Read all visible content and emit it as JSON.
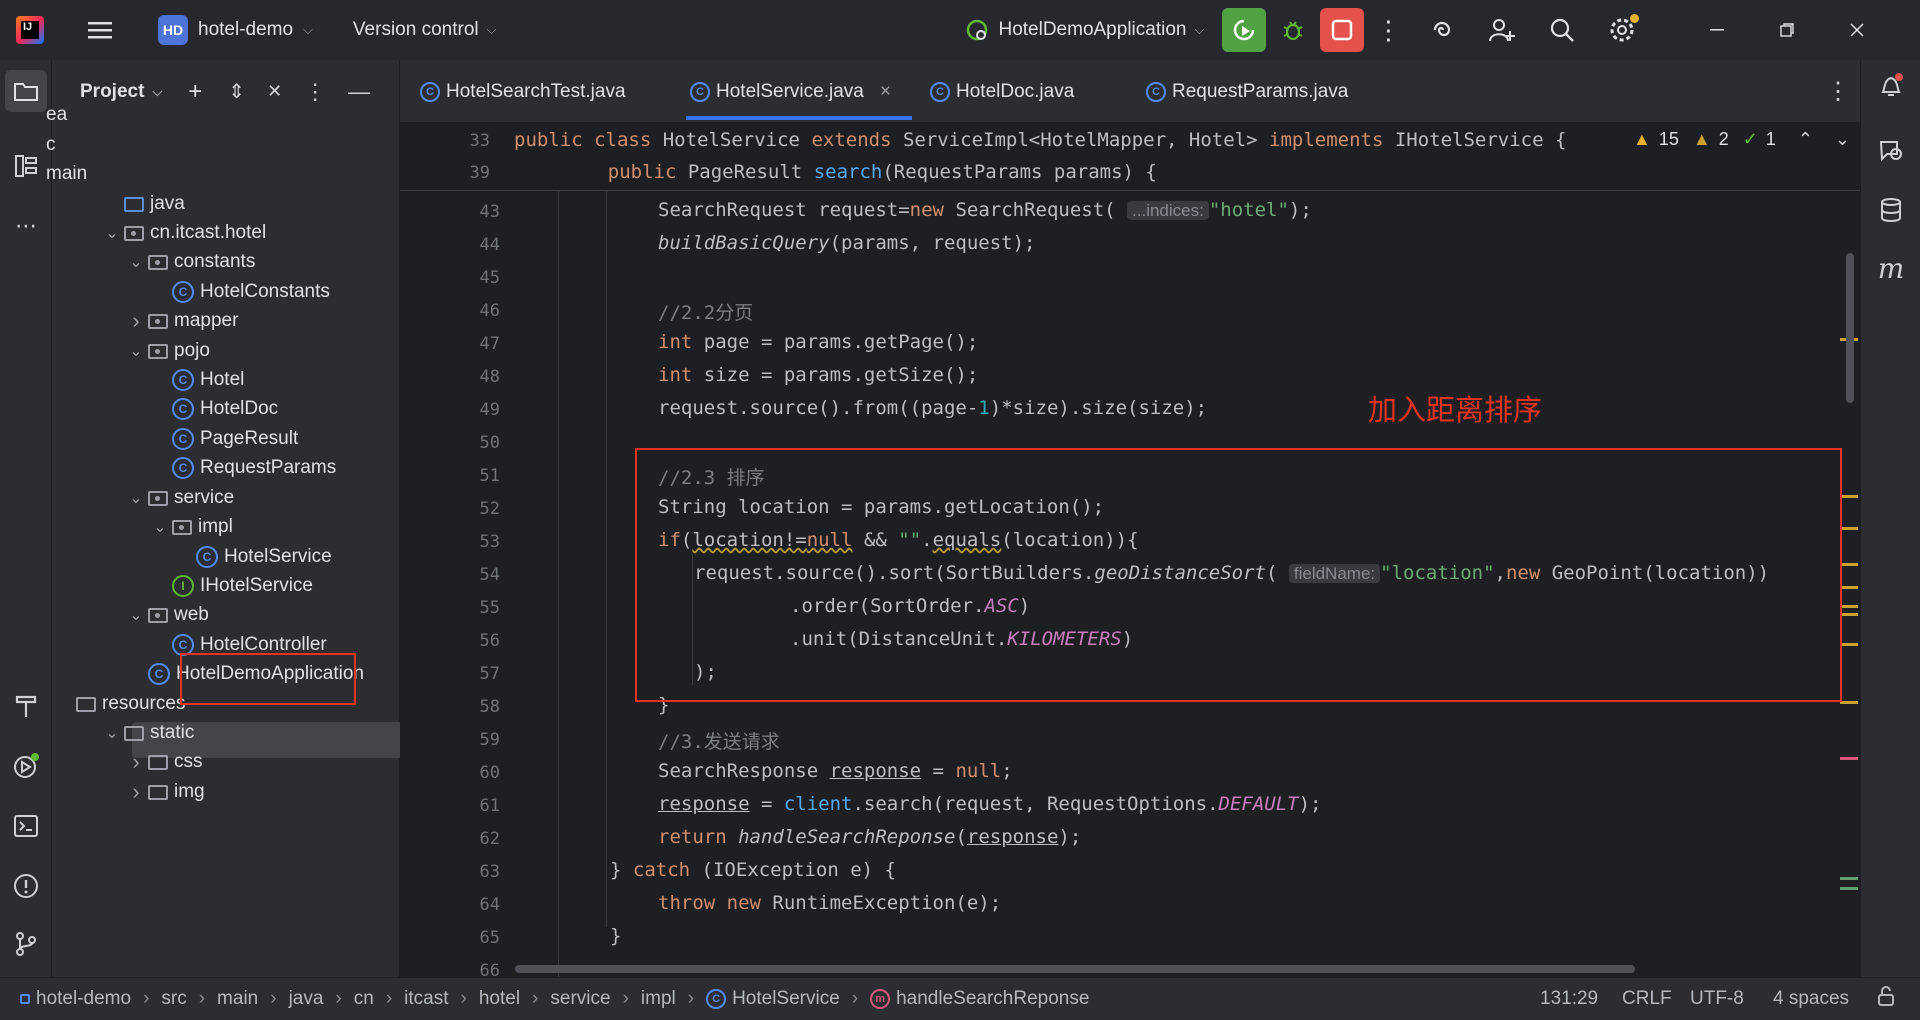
{
  "titlebar": {
    "logo_text": "IJ",
    "project_badge": "HD",
    "project_name": "hotel-demo",
    "vcs_label": "Version control",
    "run_config": "HotelDemoApplication"
  },
  "project_panel": {
    "title": "Project",
    "tree": [
      {
        "label": "ea",
        "indent": 0,
        "kind": "folder"
      },
      {
        "label": "c",
        "indent": 0,
        "kind": "folder"
      },
      {
        "label": "main",
        "indent": 0,
        "kind": "folder"
      },
      {
        "label": "java",
        "indent": 1,
        "kind": "folder-blue"
      },
      {
        "label": "cn.itcast.hotel",
        "indent": 1,
        "kind": "package"
      },
      {
        "label": "constants",
        "indent": 2,
        "kind": "package"
      },
      {
        "label": "HotelConstants",
        "indent": 3,
        "kind": "class"
      },
      {
        "label": "mapper",
        "indent": 2,
        "kind": "package"
      },
      {
        "label": "pojo",
        "indent": 2,
        "kind": "package"
      },
      {
        "label": "Hotel",
        "indent": 3,
        "kind": "class"
      },
      {
        "label": "HotelDoc",
        "indent": 3,
        "kind": "class"
      },
      {
        "label": "PageResult",
        "indent": 3,
        "kind": "class"
      },
      {
        "label": "RequestParams",
        "indent": 3,
        "kind": "class"
      },
      {
        "label": "service",
        "indent": 2,
        "kind": "package"
      },
      {
        "label": "impl",
        "indent": 3,
        "kind": "package"
      },
      {
        "label": "HotelService",
        "indent": 4,
        "kind": "class"
      },
      {
        "label": "IHotelService",
        "indent": 3,
        "kind": "interface"
      },
      {
        "label": "web",
        "indent": 2,
        "kind": "package"
      },
      {
        "label": "HotelController",
        "indent": 3,
        "kind": "class"
      },
      {
        "label": "HotelDemoApplication",
        "indent": 2,
        "kind": "class"
      },
      {
        "label": "resources",
        "indent": 0,
        "kind": "folder"
      },
      {
        "label": "static",
        "indent": 1,
        "kind": "folder"
      },
      {
        "label": "css",
        "indent": 2,
        "kind": "folder"
      },
      {
        "label": "img",
        "indent": 2,
        "kind": "folder"
      }
    ]
  },
  "tabs": [
    {
      "label": "HotelSearchTest.java"
    },
    {
      "label": "HotelService.java",
      "close": "×"
    },
    {
      "label": "HotelDoc.java"
    },
    {
      "label": "RequestParams.java"
    }
  ],
  "inspections": {
    "warnings": "15",
    "weak_warnings": "2",
    "typos": "1"
  },
  "editor": {
    "sticky": [
      {
        "ln": "33"
      },
      {
        "ln": "39"
      }
    ],
    "lines": [
      "43",
      "44",
      "45",
      "46",
      "47",
      "48",
      "49",
      "50",
      "51",
      "52",
      "53",
      "54",
      "55",
      "56",
      "57",
      "58",
      "59",
      "60",
      "61",
      "62",
      "63",
      "64",
      "65",
      "66"
    ],
    "annotation": "加入距离排序",
    "hints": {
      "indices": "...indices:",
      "fieldName": "fieldName:"
    }
  },
  "statusbar": {
    "breadcrumbs": [
      "hotel-demo",
      "src",
      "main",
      "java",
      "cn",
      "itcast",
      "hotel",
      "service",
      "impl",
      "HotelService",
      "handleSearchReponse"
    ],
    "position": "131:29",
    "line_sep": "CRLF",
    "encoding": "UTF-8",
    "indent": "4 spaces"
  },
  "colors": {
    "accent": "#3574f0",
    "annotation_red": "#e53322",
    "run_green": "#52a244",
    "stop_red": "#e5514b"
  }
}
